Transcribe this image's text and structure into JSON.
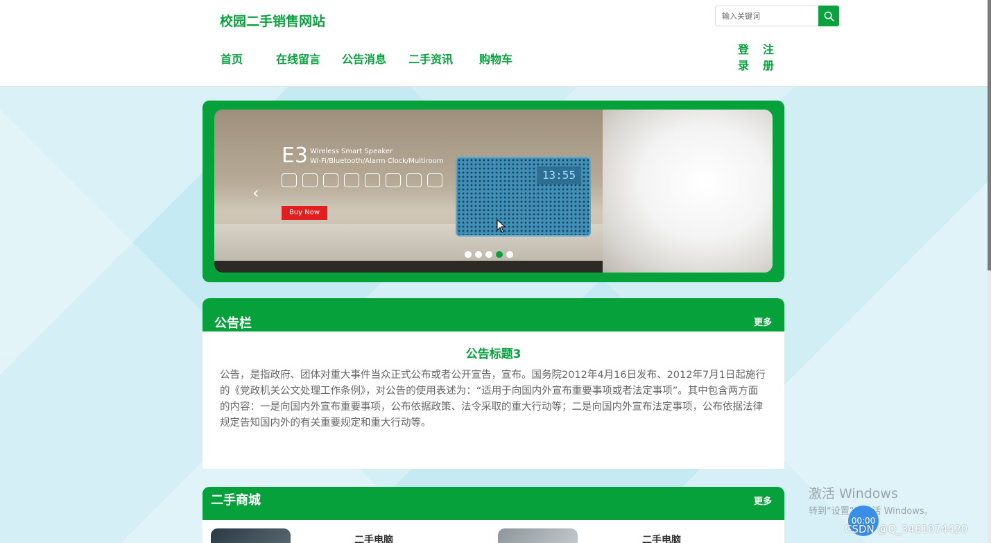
{
  "header": {
    "site_title": "校园二手销售网站",
    "search_placeholder": "输入关键词"
  },
  "nav": {
    "items": [
      {
        "label": "首页"
      },
      {
        "label": "在线留言"
      },
      {
        "label": "公告消息"
      },
      {
        "label": "二手资讯"
      },
      {
        "label": "购物车"
      }
    ],
    "login_line1": "登",
    "login_line2": "录",
    "register_line1": "注",
    "register_line2": "册"
  },
  "carousel": {
    "product_model": "E3",
    "subtitle_line1": "Wireless Smart Speaker",
    "subtitle_line2": "Wi-Fi/Bluetooth/Alarm Clock/Multiroom",
    "buy_label": "Buy Now",
    "display_time": "13:55",
    "active_slide": 4,
    "slide_count": 5
  },
  "notice": {
    "section_title": "公告栏",
    "more_label": "更多",
    "title": "公告标题3",
    "text": "公告，是指政府、团体对重大事件当众正式公布或者公开宣告，宣布。国务院2012年4月16日发布、2012年7月1日起施行的《党政机关公文处理工作条例》，对公告的使用表述为：“适用于向国内外宣布重要事项或者法定事项”。其中包含两方面的内容：一是向国内外宣布重要事项，公布依据政策、法令采取的重大行动等；二是向国内外宣布法定事项，公布依据法律规定告知国内外的有关重要规定和重大行动等。"
  },
  "shop": {
    "section_title": "二手商城",
    "more_label": "更多",
    "products": [
      {
        "name": "二手电脑"
      },
      {
        "name": "二手电脑"
      }
    ]
  },
  "overlay": {
    "windows_line1": "激活 Windows",
    "windows_line2": "转到“设置”以激活 Windows。",
    "timer": "00:00",
    "watermark": "CSDN @Q_3461074420"
  },
  "colors": {
    "brand_green": "#0aa23f",
    "page_bg": "#c9ebf3"
  }
}
